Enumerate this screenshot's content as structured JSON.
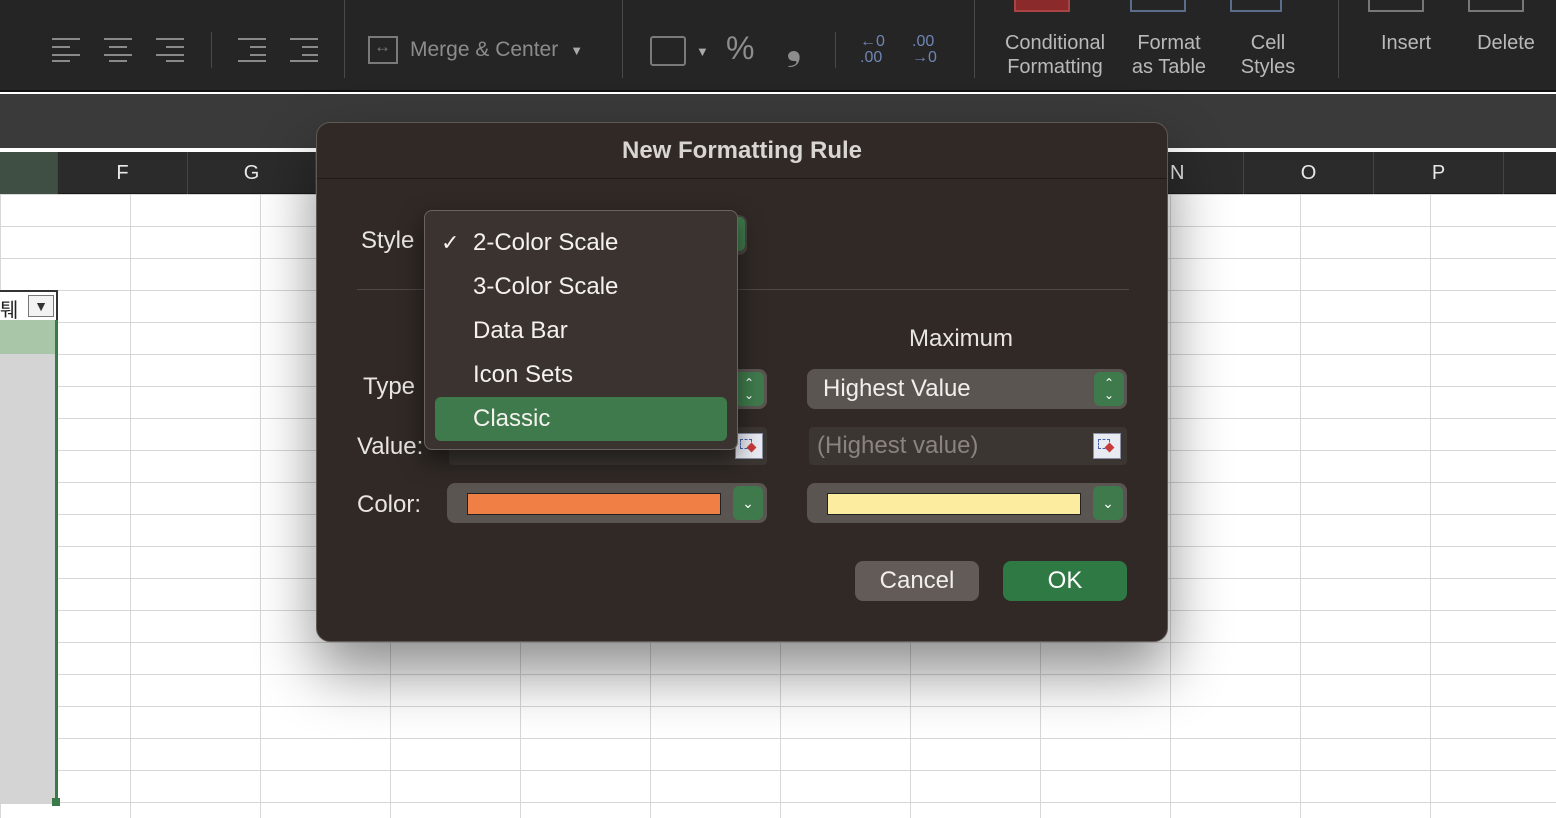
{
  "ribbon": {
    "merge_label": "Merge & Center",
    "groups": [
      {
        "line1": "Conditional",
        "line2": "Formatting"
      },
      {
        "line1": "Format",
        "line2": "as Table"
      },
      {
        "line1": "Cell",
        "line2": "Styles"
      },
      {
        "line1": "Insert",
        "line2": ""
      },
      {
        "line1": "Delete",
        "line2": ""
      }
    ],
    "percent_symbol": "%",
    "comma_symbol": "❟",
    "decrease_decimal_label": "←0 .00",
    "increase_decimal_label": ".00 →0"
  },
  "sheet": {
    "columns": [
      "F",
      "G",
      "N",
      "O",
      "P"
    ],
    "filter_cell_text": "퉤",
    "selection_color": "#3a7a4a"
  },
  "dialog": {
    "title": "New Formatting Rule",
    "style_label": "Style",
    "style_menu": {
      "items": [
        {
          "label": "2-Color Scale",
          "checked": true
        },
        {
          "label": "3-Color Scale",
          "checked": false
        },
        {
          "label": "Data Bar",
          "checked": false
        },
        {
          "label": "Icon Sets",
          "checked": false
        },
        {
          "label": "Classic",
          "checked": false,
          "highlighted": true
        }
      ],
      "check_glyph": "✓"
    },
    "maximum_heading": "Maximum",
    "type_label": "Type",
    "value_label": "Value:",
    "color_label": "Color:",
    "max_type": "Highest Value",
    "max_value_placeholder": "(Highest value)",
    "min_color": "#f07f45",
    "max_color": "#fbeca0",
    "cancel_label": "Cancel",
    "ok_label": "OK",
    "accent_color": "#3f7a4c"
  }
}
